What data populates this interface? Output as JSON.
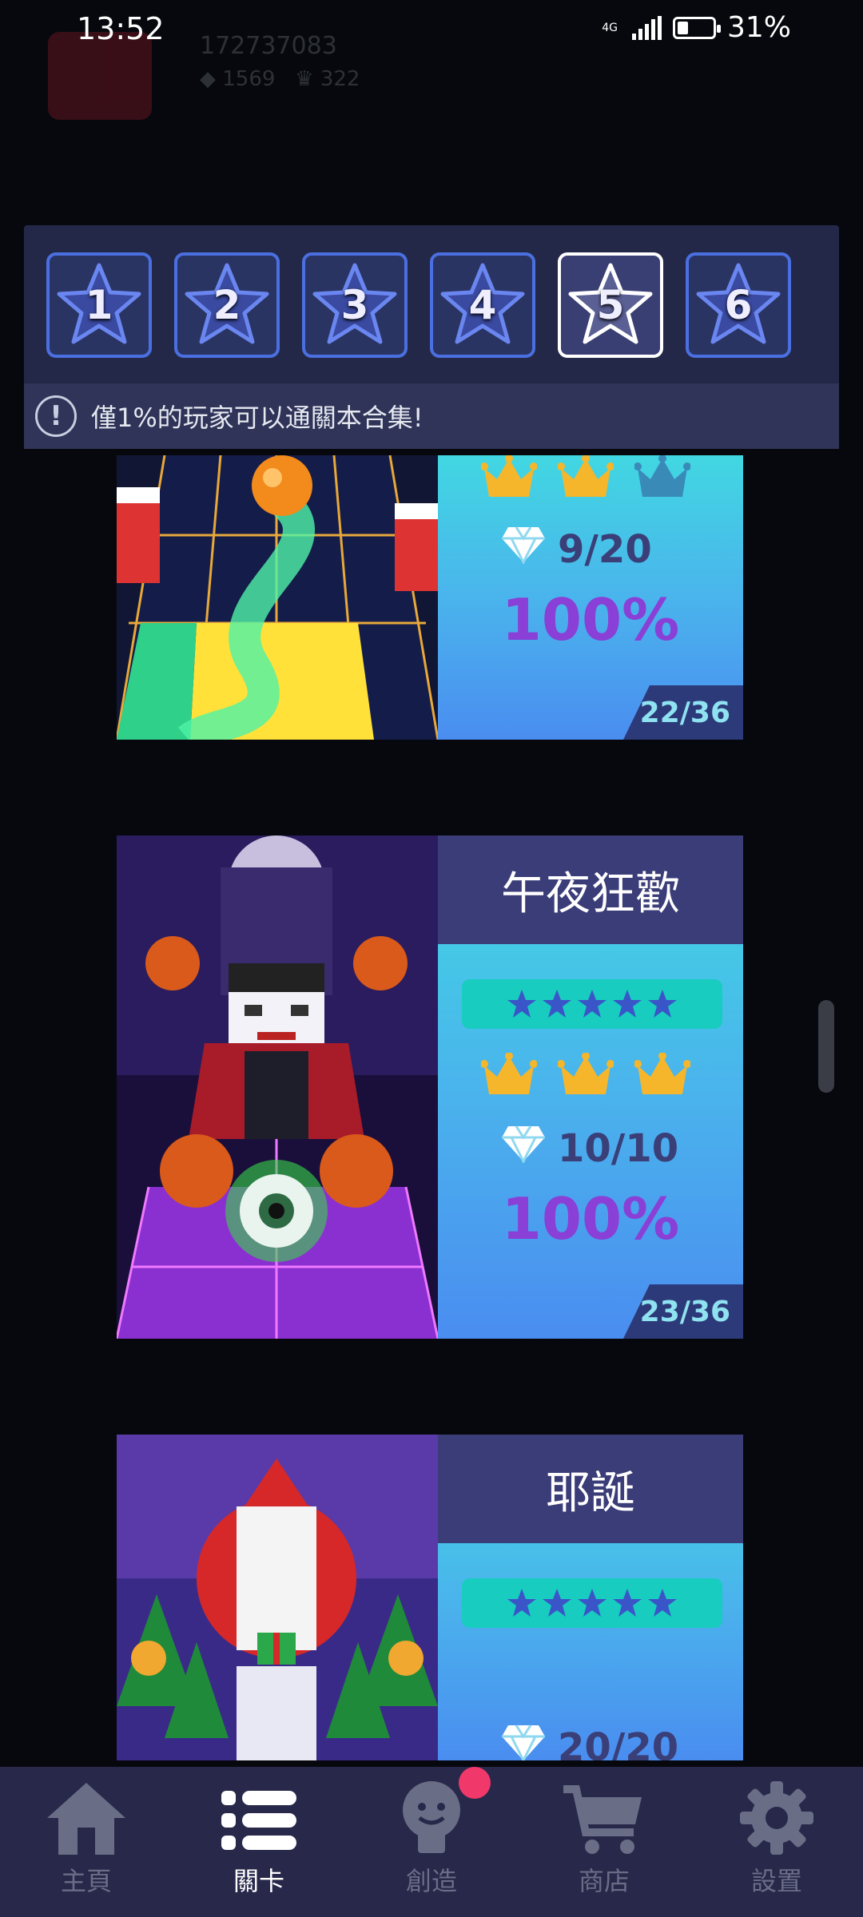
{
  "status_bar": {
    "time": "13:52",
    "network": "4G",
    "battery": "31%",
    "battery_level": 0.31
  },
  "background": {
    "player_id": "172737083",
    "gems": "1569",
    "crowns": "322"
  },
  "level_selector": {
    "levels": [
      "1",
      "2",
      "3",
      "4",
      "5",
      "6"
    ],
    "selected": "5",
    "notice": "僅1%的玩家可以通關本合集!"
  },
  "songs": [
    {
      "crowns_earned": 2,
      "gems": "9/20",
      "percent": "100%",
      "count": "22/36"
    },
    {
      "title": "午夜狂歡",
      "stars": 5,
      "crowns_earned": 3,
      "gems": "10/10",
      "percent": "100%",
      "count": "23/36"
    },
    {
      "title": "耶誕",
      "stars": 5,
      "gems": "20/20"
    }
  ],
  "nav": {
    "items": [
      {
        "label": "主頁",
        "icon": "home-icon"
      },
      {
        "label": "關卡",
        "icon": "list-icon"
      },
      {
        "label": "創造",
        "icon": "lightbulb-icon"
      },
      {
        "label": "商店",
        "icon": "cart-icon"
      },
      {
        "label": "設置",
        "icon": "gear-icon"
      }
    ],
    "active": "關卡"
  },
  "colors": {
    "accent_gold": "#f5b62c",
    "accent_purple": "#8a3fd6",
    "nav_bg": "#27284a",
    "badge": "#f0386a"
  }
}
